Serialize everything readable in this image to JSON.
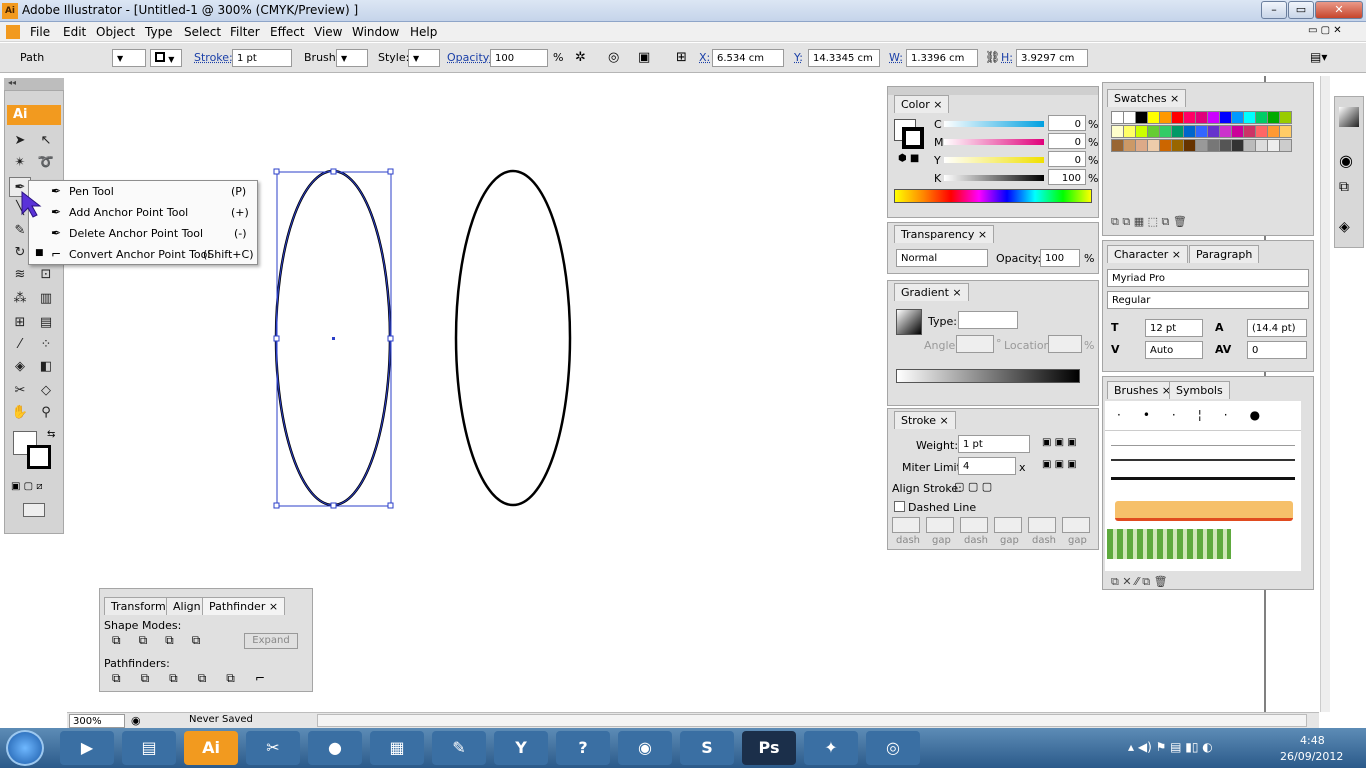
{
  "window": {
    "title": "Adobe Illustrator - [Untitled-1 @ 300% (CMYK/Preview) ]",
    "logo": "Ai"
  },
  "menus": [
    "File",
    "Edit",
    "Object",
    "Type",
    "Select",
    "Filter",
    "Effect",
    "View",
    "Window",
    "Help"
  ],
  "control": {
    "selection": "Path",
    "stroke_label": "Stroke:",
    "stroke_value": "1 pt",
    "brush_label": "Brush:",
    "style_label": "Style:",
    "opacity_label": "Opacity:",
    "opacity_value": "100",
    "opacity_unit": "%",
    "x_label": "X:",
    "x_value": "6.534 cm",
    "y_label": "Y:",
    "y_value": "14.3345 cm",
    "w_label": "W:",
    "w_value": "1.3396 cm",
    "h_label": "H:",
    "h_value": "3.9297 cm"
  },
  "toolbox": {
    "logo": "Ai"
  },
  "flyout": [
    {
      "name": "Pen Tool",
      "shortcut": "(P)"
    },
    {
      "name": "Add Anchor Point Tool",
      "shortcut": "(+)"
    },
    {
      "name": "Delete Anchor Point Tool",
      "shortcut": "(-)"
    },
    {
      "name": "Convert Anchor Point Tool",
      "shortcut": "(Shift+C)"
    }
  ],
  "color_panel": {
    "tab": "Color",
    "labels": [
      "C",
      "M",
      "Y",
      "K"
    ],
    "values": [
      "0",
      "0",
      "0",
      "100"
    ],
    "unit": "%"
  },
  "transparency_panel": {
    "tab": "Transparency",
    "mode": "Normal",
    "opacity_label": "Opacity:",
    "opacity": "100",
    "unit": "%"
  },
  "gradient_panel": {
    "tab": "Gradient",
    "type_label": "Type:",
    "angle_label": "Angle:",
    "location_label": "Location:",
    "deg": "°",
    "unit": "%"
  },
  "stroke_panel": {
    "tab": "Stroke",
    "weight_label": "Weight:",
    "weight": "1 pt",
    "miter_label": "Miter Limit:",
    "miter": "4",
    "x": "x",
    "align_label": "Align Stroke:",
    "dashed_label": "Dashed Line",
    "dash_labels": [
      "dash",
      "gap",
      "dash",
      "gap",
      "dash",
      "gap"
    ]
  },
  "swatches_panel": {
    "tab": "Swatches"
  },
  "character_panel": {
    "tabs": [
      "Character",
      "Paragraph"
    ],
    "font": "Myriad Pro",
    "style": "Regular",
    "size": "12 pt",
    "leading": "(14.4 pt)",
    "kerning": "Auto",
    "tracking": "0"
  },
  "brushes_panel": {
    "tabs": [
      "Brushes",
      "Symbols"
    ]
  },
  "pathfinder_panel": {
    "tabs": [
      "Transform",
      "Align",
      "Pathfinder"
    ],
    "shape_modes": "Shape Modes:",
    "expand": "Expand",
    "pathfinders": "Pathfinders:"
  },
  "status": {
    "zoom": "300%",
    "saved": "Never Saved"
  },
  "clock": {
    "time": "4:48",
    "date": "26/09/2012"
  },
  "colors": {
    "ai_orange": "#f29a1f",
    "selection_blue": "#2b3fc8"
  }
}
